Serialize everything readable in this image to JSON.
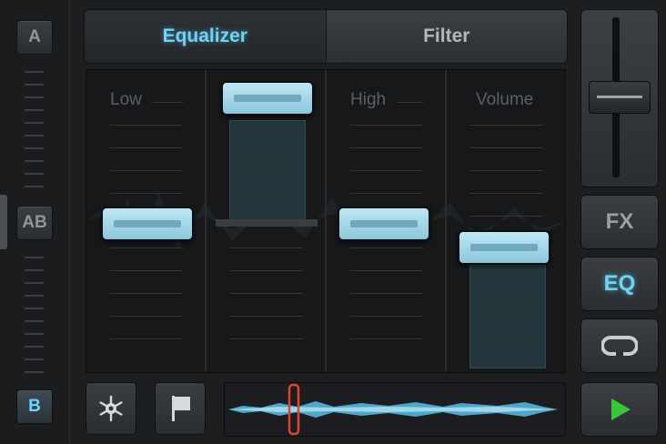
{
  "crossfader": {
    "deck_a_label": "A",
    "center_label": "AB",
    "deck_b_label": "B"
  },
  "tabs": [
    {
      "label": "Equalizer",
      "active": true
    },
    {
      "label": "Filter",
      "active": false
    }
  ],
  "eq": {
    "bands": [
      {
        "label": "Low",
        "level": 0.5
      },
      {
        "label": "",
        "level": 0.97
      },
      {
        "label": "High",
        "level": 0.5
      },
      {
        "label": "Volume",
        "level": 0.42
      }
    ]
  },
  "toolbar": {
    "settings_icon": "snowflake-gear-icon",
    "cue_icon": "flag-icon",
    "playhead_position": 0.2
  },
  "side_buttons": {
    "fx_label": "FX",
    "eq_label": "EQ",
    "loop_icon": "loop-icon",
    "play_icon": "play-icon"
  },
  "colors": {
    "accent": "#72d2f4",
    "knob": "#a9d9eb",
    "playhead": "#e0452a",
    "play": "#3cc43c"
  }
}
